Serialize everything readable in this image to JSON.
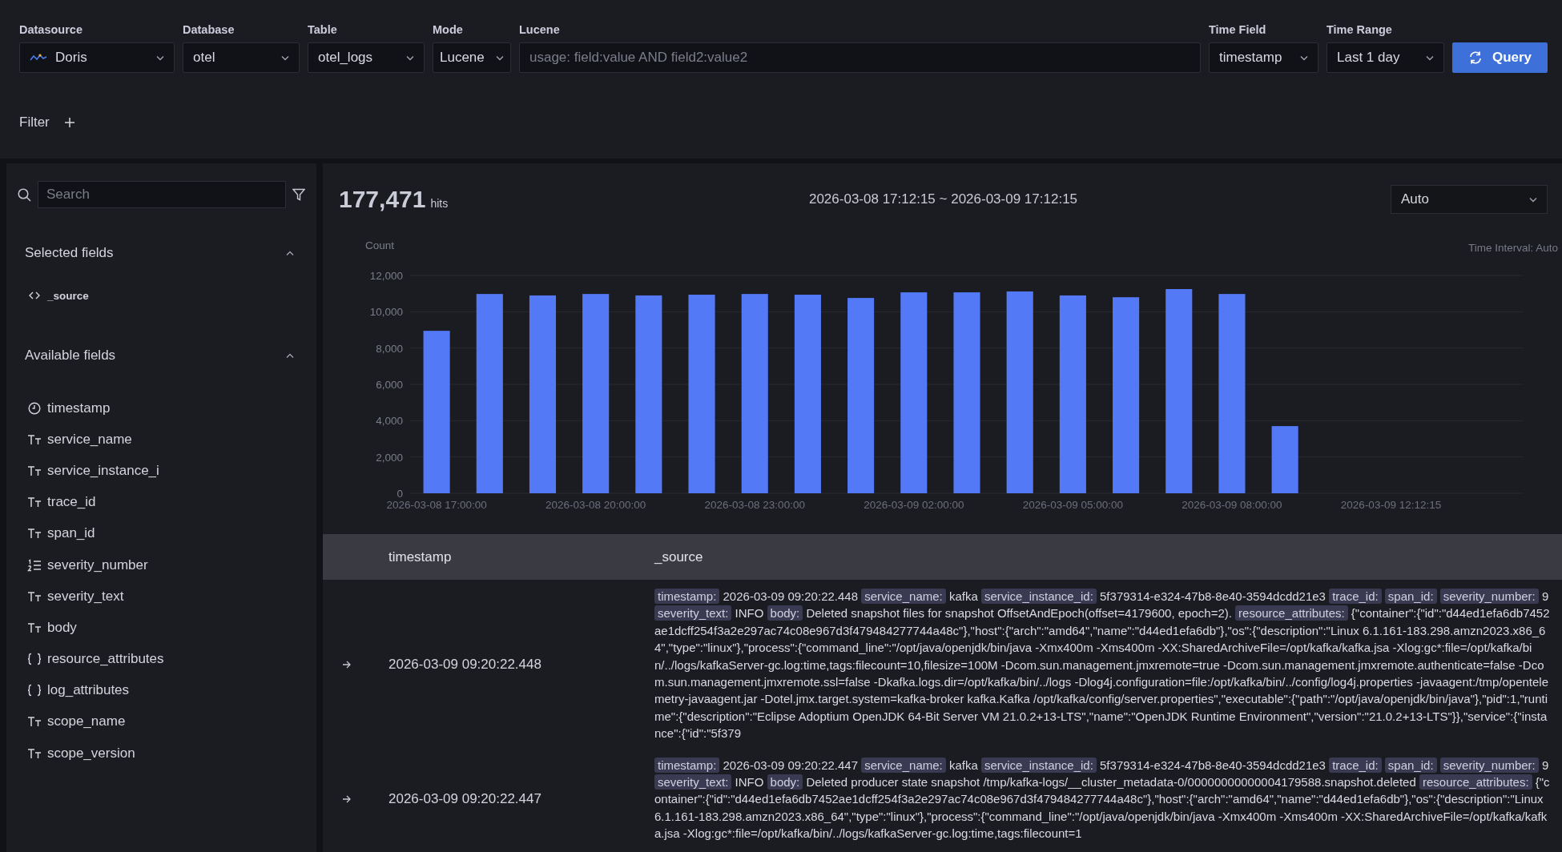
{
  "query_bar": {
    "fields": [
      {
        "kind": "select",
        "label": "Datasource",
        "value": "Doris",
        "logo": true
      },
      {
        "kind": "select",
        "label": "Database",
        "value": "otel"
      },
      {
        "kind": "select",
        "label": "Table",
        "value": "otel_logs"
      },
      {
        "kind": "select",
        "label": "Mode",
        "value": "Lucene"
      },
      {
        "kind": "input",
        "label": "Lucene",
        "placeholder": "usage: field:value AND field2:value2"
      },
      {
        "kind": "select",
        "label": "Time Field",
        "value": "timestamp"
      },
      {
        "kind": "select",
        "label": "Time Range",
        "value": "Last 1 day"
      },
      {
        "kind": "button",
        "label": "Query"
      }
    ],
    "filter": {
      "label": "Filter"
    }
  },
  "sidebar": {
    "search": {
      "placeholder": "Search"
    },
    "sections": [
      {
        "title": "Selected fields",
        "expanded": true,
        "fields": [
          {
            "name": "_source",
            "kind": "source"
          }
        ]
      },
      {
        "title": "Available fields",
        "expanded": true,
        "fields": [
          {
            "name": "timestamp",
            "kind": "date"
          },
          {
            "name": "service_name",
            "kind": "string"
          },
          {
            "name": "service_instance_i",
            "kind": "string"
          },
          {
            "name": "trace_id",
            "kind": "string"
          },
          {
            "name": "span_id",
            "kind": "string"
          },
          {
            "name": "severity_number",
            "kind": "number"
          },
          {
            "name": "severity_text",
            "kind": "string"
          },
          {
            "name": "body",
            "kind": "string"
          },
          {
            "name": "resource_attributes",
            "kind": "json"
          },
          {
            "name": "log_attributes",
            "kind": "json"
          },
          {
            "name": "scope_name",
            "kind": "string"
          },
          {
            "name": "scope_version",
            "kind": "string"
          }
        ]
      }
    ]
  },
  "results": {
    "hits": "177,471",
    "hits_unit": "hits",
    "range": "2026-03-08 17:12:15 ~ 2026-03-09 17:12:15",
    "interval_select": {
      "value": "Auto"
    },
    "interval_note": "Time Interval: Auto",
    "chart_data": {
      "type": "bar",
      "ylabel": "Count",
      "categories": [
        "2026-03-08 17:00:00",
        null,
        null,
        "2026-03-08 20:00:00",
        null,
        null,
        "2026-03-08 23:00:00",
        null,
        null,
        "2026-03-09 02:00:00",
        null,
        null,
        "2026-03-09 05:00:00",
        null,
        null,
        "2026-03-09 08:00:00",
        null,
        null,
        "2026-03-09 12:12:15",
        null,
        null
      ],
      "values": [
        8950,
        10980,
        10900,
        10980,
        10900,
        10940,
        10980,
        10940,
        10760,
        11070,
        11070,
        11120,
        10900,
        10800,
        11250,
        10980,
        3700,
        null,
        null,
        null,
        null
      ],
      "ylim": [
        0,
        12000
      ],
      "grid": true,
      "yticks": [
        {
          "value": 0,
          "label": "0"
        },
        {
          "value": 2000,
          "label": "2,000"
        },
        {
          "value": 4000,
          "label": "4,000"
        },
        {
          "value": 6000,
          "label": "6,000"
        },
        {
          "value": 8000,
          "label": "8,000"
        },
        {
          "value": 10000,
          "label": "10,000"
        },
        {
          "value": 12000,
          "label": "12,000"
        }
      ]
    }
  },
  "log_table": {
    "columns": [
      "timestamp",
      "_source"
    ],
    "rows": [
      {
        "timestamp": "2026-03-09 09:20:22.448",
        "source": [
          {
            "key": "timestamp:",
            "value": "2026-03-09 09:20:22.448"
          },
          {
            "key": "service_name:",
            "value": "kafka"
          },
          {
            "key": "service_instance_id:",
            "value": "5f379314-e324-47b8-8e40-3594dcdd21e3"
          },
          {
            "key": "trace_id:"
          },
          {
            "key": "span_id:"
          },
          {
            "key": "severity_number:",
            "value": "9"
          },
          {
            "key": "severity_text:",
            "value": "INFO"
          },
          {
            "key": "body:",
            "value": "Deleted snapshot files for snapshot OffsetAndEpoch(offset=4179600, epoch=2)."
          },
          {
            "key": "resource_attributes:",
            "value": "{\"container\":{\"id\":\"d44ed1efa6db7452ae1dcff254f3a2e297ac74c08e967d3f479484277744a48c\"},\"host\":{\"arch\":\"amd64\",\"name\":\"d44ed1efa6db\"},\"os\":{\"description\":\"Linux 6.1.161-183.298.amzn2023.x86_64\",\"type\":\"linux\"},\"process\":{\"command_line\":\"/opt/java/openjdk/bin/java -Xmx400m -Xms400m -XX:SharedArchiveFile=/opt/kafka/kafka.jsa -Xlog:gc*:file=/opt/kafka/bin/../logs/kafkaServer-gc.log:time,tags:filecount=10,filesize=100M -Dcom.sun.management.jmxremote=true -Dcom.sun.management.jmxremote.authenticate=false -Dcom.sun.management.jmxremote.ssl=false -Dkafka.logs.dir=/opt/kafka/bin/../logs -Dlog4j.configuration=file:/opt/kafka/bin/../config/log4j.properties -javaagent:/tmp/opentelemetry-javaagent.jar -Dotel.jmx.target.system=kafka-broker kafka.Kafka /opt/kafka/config/server.properties\",\"executable\":{\"path\":\"/opt/java/openjdk/bin/java\"},\"pid\":1,\"runtime\":{\"description\":\"Eclipse Adoptium OpenJDK 64-Bit Server VM 21.0.2+13-LTS\",\"name\":\"OpenJDK Runtime Environment\",\"version\":\"21.0.2+13-LTS\"}},\"service\":{\"instance\":{\"id\":\"5f379"
          }
        ]
      },
      {
        "timestamp": "2026-03-09 09:20:22.447",
        "source": [
          {
            "key": "timestamp:",
            "value": "2026-03-09 09:20:22.447"
          },
          {
            "key": "service_name:",
            "value": "kafka"
          },
          {
            "key": "service_instance_id:",
            "value": "5f379314-e324-47b8-8e40-3594dcdd21e3"
          },
          {
            "key": "trace_id:"
          },
          {
            "key": "span_id:"
          },
          {
            "key": "severity_number:",
            "value": "9"
          },
          {
            "key": "severity_text:",
            "value": "INFO"
          },
          {
            "key": "body:",
            "value": "Deleted producer state snapshot /tmp/kafka-logs/__cluster_metadata-0/00000000000004179588.snapshot.deleted"
          },
          {
            "key": "resource_attributes:",
            "value": "{\"container\":{\"id\":\"d44ed1efa6db7452ae1dcff254f3a2e297ac74c08e967d3f479484277744a48c\"},\"host\":{\"arch\":\"amd64\",\"name\":\"d44ed1efa6db\"},\"os\":{\"description\":\"Linux 6.1.161-183.298.amzn2023.x86_64\",\"type\":\"linux\"},\"process\":{\"command_line\":\"/opt/java/openjdk/bin/java -Xmx400m -Xms400m -XX:SharedArchiveFile=/opt/kafka/kafka.jsa -Xlog:gc*:file=/opt/kafka/bin/../logs/kafkaServer-gc.log:time,tags:filecount=1"
          }
        ]
      }
    ]
  }
}
